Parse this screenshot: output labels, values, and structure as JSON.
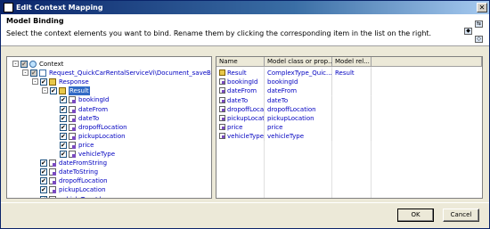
{
  "window": {
    "title": "Edit Context Mapping",
    "close_label": "✕"
  },
  "header": {
    "title": "Model Binding",
    "description": "Select the context elements you want to bind. Rename them by clicking the corresponding item in the list on the right."
  },
  "tree": {
    "items": [
      {
        "label": "Context",
        "level": 0,
        "expander": "-",
        "icon": "context-icon",
        "state": "partial"
      },
      {
        "label": "Request_QuickCarRentalServiceVi\\Document_saveBooking",
        "level": 1,
        "expander": "-",
        "icon": "context-node-icon",
        "state": "partial"
      },
      {
        "label": "Response",
        "level": 2,
        "expander": "-",
        "icon": "node-icon",
        "state": "checked"
      },
      {
        "label": "Result",
        "level": 3,
        "expander": "-",
        "icon": "node-icon",
        "state": "checked",
        "selected": true
      },
      {
        "label": "bookingId",
        "level": 4,
        "icon": "attribute-icon",
        "state": "checked"
      },
      {
        "label": "dateFrom",
        "level": 4,
        "icon": "attribute-icon",
        "state": "checked"
      },
      {
        "label": "dateTo",
        "level": 4,
        "icon": "attribute-icon",
        "state": "checked"
      },
      {
        "label": "dropoffLocation",
        "level": 4,
        "icon": "attribute-icon",
        "state": "checked"
      },
      {
        "label": "pickupLocation",
        "level": 4,
        "icon": "attribute-icon",
        "state": "checked"
      },
      {
        "label": "price",
        "level": 4,
        "icon": "attribute-icon",
        "state": "checked"
      },
      {
        "label": "vehicleType",
        "level": 4,
        "icon": "attribute-icon",
        "state": "checked"
      },
      {
        "label": "dateFromString",
        "level": 2,
        "icon": "attribute-icon",
        "state": "checked"
      },
      {
        "label": "dateToString",
        "level": 2,
        "icon": "attribute-icon",
        "state": "checked"
      },
      {
        "label": "dropoffLocation",
        "level": 2,
        "icon": "attribute-icon",
        "state": "checked"
      },
      {
        "label": "pickupLocation",
        "level": 2,
        "icon": "attribute-icon",
        "state": "checked"
      },
      {
        "label": "vehicleTypeId",
        "level": 2,
        "icon": "attribute-icon",
        "state": "checked"
      }
    ]
  },
  "table": {
    "columns": [
      "Name",
      "Model class or prop...",
      "Model rel..."
    ],
    "rows": [
      {
        "name": "Result",
        "icon": "node-icon",
        "model": "ComplexType_Quic...",
        "relation": "Result"
      },
      {
        "name": "bookingId",
        "icon": "attribute-icon",
        "model": "bookingId",
        "relation": ""
      },
      {
        "name": "dateFrom",
        "icon": "attribute-icon",
        "model": "dateFrom",
        "relation": ""
      },
      {
        "name": "dateTo",
        "icon": "attribute-icon",
        "model": "dateTo",
        "relation": ""
      },
      {
        "name": "dropoffLocat...",
        "icon": "attribute-icon",
        "model": "dropoffLocation",
        "relation": ""
      },
      {
        "name": "pickupLocati...",
        "icon": "attribute-icon",
        "model": "pickupLocation",
        "relation": ""
      },
      {
        "name": "price",
        "icon": "attribute-icon",
        "model": "price",
        "relation": ""
      },
      {
        "name": "vehicleType",
        "icon": "attribute-icon",
        "model": "vehicleType",
        "relation": ""
      }
    ]
  },
  "buttons": {
    "ok": "OK",
    "cancel": "Cancel"
  },
  "colors": {
    "title_bar": "#0a246a",
    "selection": "#316ac5",
    "link_text": "#0000c0"
  }
}
